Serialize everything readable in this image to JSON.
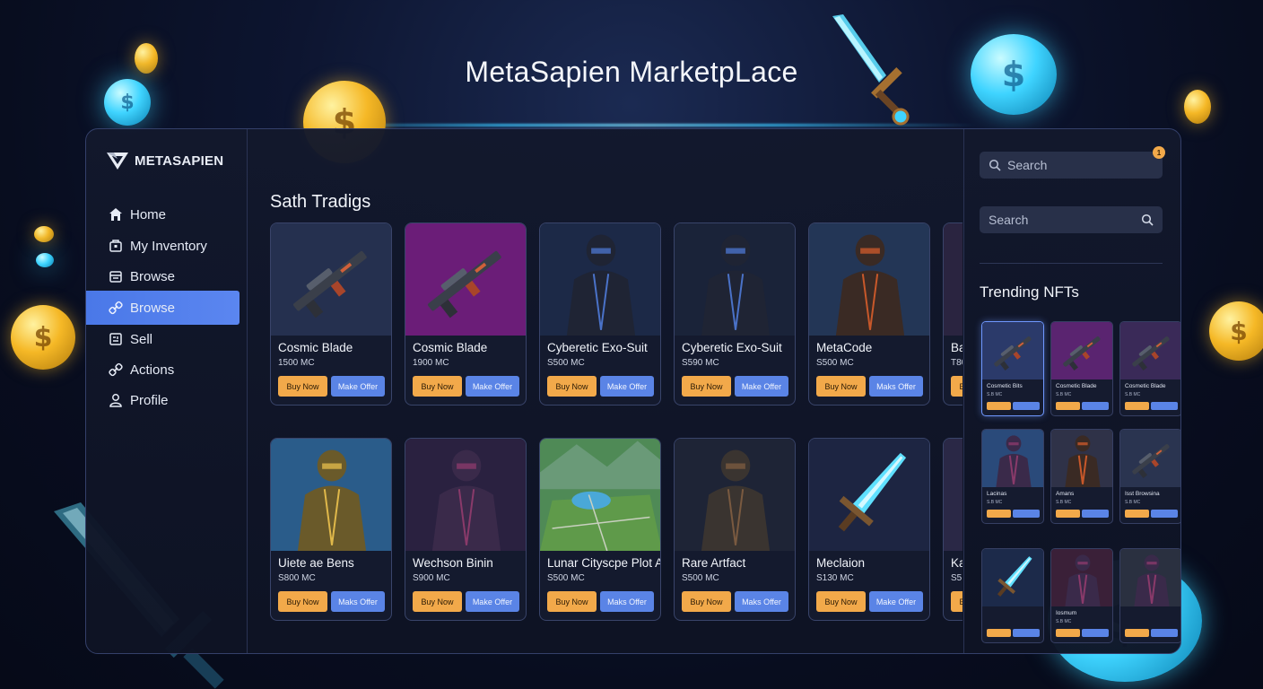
{
  "page_title": "MetaSapien MarketpLace",
  "brand": {
    "name": "METASAPIEN",
    "logo_icon": "metasapien-logo-icon"
  },
  "sidebar": {
    "items": [
      {
        "label": "Home",
        "icon": "home-icon",
        "active": false
      },
      {
        "label": "My Inventory",
        "icon": "inventory-icon",
        "active": false
      },
      {
        "label": "Browse",
        "icon": "browse-icon",
        "active": false
      },
      {
        "label": "Browse",
        "icon": "browse-link-icon",
        "active": true
      },
      {
        "label": "Sell",
        "icon": "sell-icon",
        "active": false
      },
      {
        "label": "Actions",
        "icon": "actions-icon",
        "active": false
      },
      {
        "label": "Profile",
        "icon": "profile-icon",
        "active": false
      }
    ]
  },
  "main": {
    "section_title": "Sath Tradigs",
    "buy_label": "Buy Now",
    "rows": [
      [
        {
          "name": "Cosmic Blade",
          "price": "1500 MC",
          "offer": "Make Offer",
          "art": "rifle-art",
          "bg": "#25304f"
        },
        {
          "name": "Cosmic Blade",
          "price": "1900 MC",
          "offer": "Make Offer",
          "art": "rifle-art",
          "bg": "#6b1d78"
        },
        {
          "name": "Cyberetic Exo-Suit",
          "price": "S500 MC",
          "offer": "Make Offer",
          "art": "hooded-character-art",
          "bg": "#1c2947"
        },
        {
          "name": "Cyberetic Exo-Suit",
          "price": "S590 MC",
          "offer": "Make Offer",
          "art": "hooded-character-art",
          "bg": "#1a2339"
        },
        {
          "name": "MetaCode",
          "price": "S500 MC",
          "offer": "Maks Offer",
          "art": "armored-character-art",
          "bg": "#233656"
        },
        {
          "name": "Ba",
          "price": "T80",
          "offer": "",
          "art": "partial-art",
          "bg": "#2a2440"
        }
      ],
      [
        {
          "name": "Uiete ae Bens",
          "price": "S800 MC",
          "offer": "Maks Offer",
          "art": "gold-armor-art",
          "bg": "#2a5c8a"
        },
        {
          "name": "Wechson Binin",
          "price": "S900 MC",
          "offer": "Make Offer",
          "art": "character-art",
          "bg": "#2a2140"
        },
        {
          "name": "Lunar Cityscpe Plot A",
          "price": "S500 MC",
          "offer": "Maks Offer",
          "art": "land-plot-art",
          "bg": "#4f8a56"
        },
        {
          "name": "Rare Artfact",
          "price": "S500 MC",
          "offer": "Maks Offer",
          "art": "masked-character-art",
          "bg": "#1e2436"
        },
        {
          "name": "Meclaion",
          "price": "S130 MC",
          "offer": "Make Offer",
          "art": "crystal-sword-art",
          "bg": "#1d2542"
        },
        {
          "name": "Ka",
          "price": "S5",
          "offer": "",
          "art": "partial-art",
          "bg": "#2a2846"
        }
      ]
    ]
  },
  "right_panel": {
    "search_top_placeholder": "Search",
    "search_bottom_placeholder": "Search",
    "notification_count": "1",
    "trending_title": "Trending NFTs",
    "trending": [
      {
        "name": "Cosmetic Bits",
        "price": "S.B MC",
        "art": "rifle-art",
        "bg": "#2b3a6a"
      },
      {
        "name": "Cosmetic Blade",
        "price": "S.B MC",
        "art": "rifle-art",
        "bg": "#5a2470"
      },
      {
        "name": "Cosmetic Blade",
        "price": "S.B MC",
        "art": "rifle-art",
        "bg": "#3a2a58"
      },
      {
        "name": "Lacinas",
        "price": "S.B MC",
        "art": "character-art",
        "bg": "#2a4a7a"
      },
      {
        "name": "Amans",
        "price": "S.B MC",
        "art": "armored-character-art",
        "bg": "#2f3248"
      },
      {
        "name": "Isst Browsina",
        "price": "S.B MC",
        "art": "rifle-art",
        "bg": "#2a3450"
      },
      {
        "name": "",
        "price": "",
        "art": "crystal-sword-art",
        "bg": "#1c2a4a"
      },
      {
        "name": "Iosmum",
        "price": "S.B MC",
        "art": "character-art",
        "bg": "#3a2038"
      },
      {
        "name": "",
        "price": "",
        "art": "character-art",
        "bg": "#2a3040"
      }
    ]
  },
  "colors": {
    "accent": "#5b86f0",
    "buy": "#f2a94a",
    "offer": "#5a84e6",
    "coin_gold": "#f5b826",
    "coin_cyan": "#3fd4ff"
  }
}
